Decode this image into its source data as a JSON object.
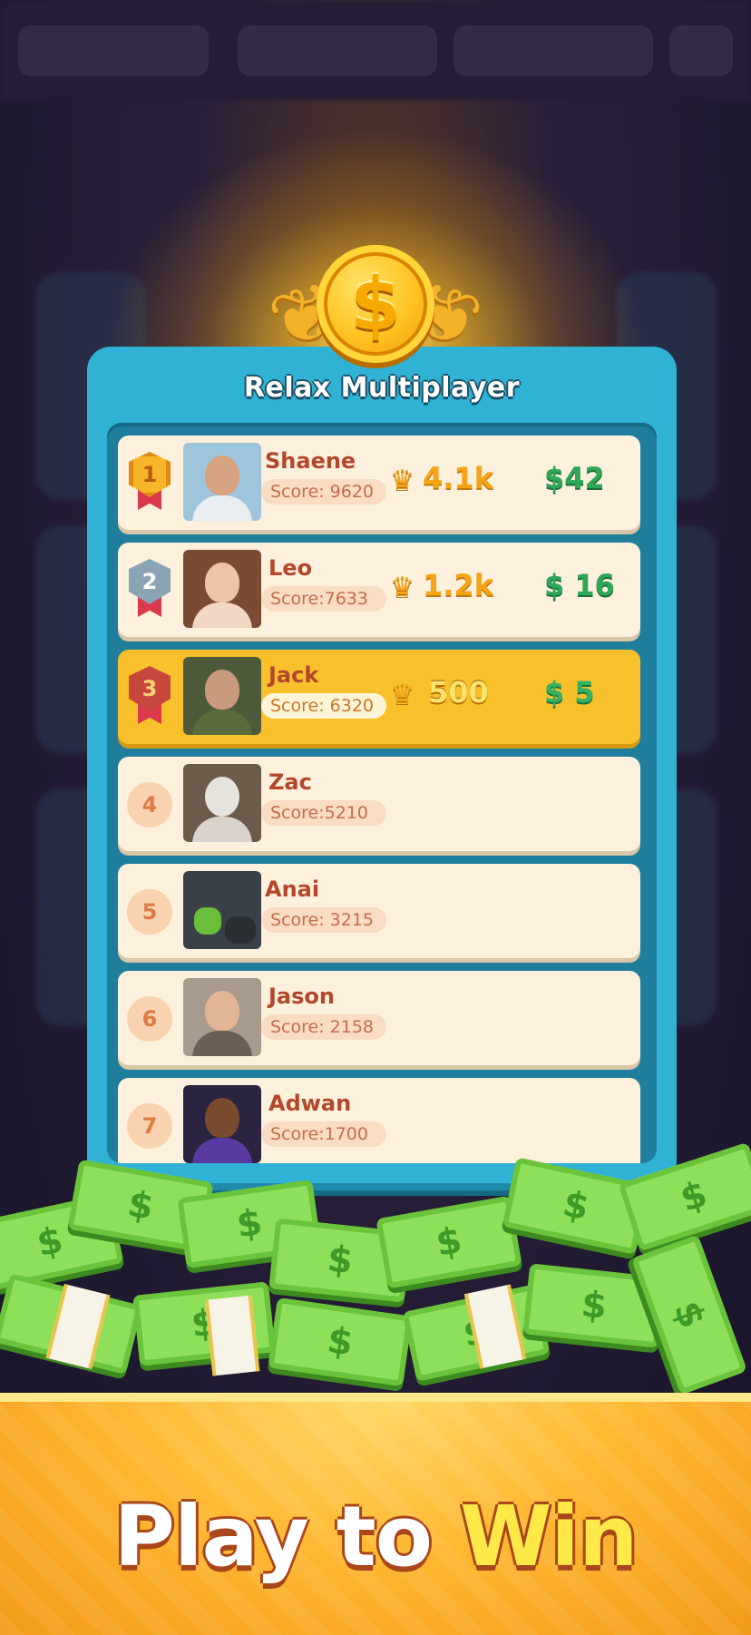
{
  "panel": {
    "title": "Relax Multiplayer"
  },
  "leaderboard": [
    {
      "rank": "1",
      "name": "Shaene",
      "score": "Score: 9620",
      "crowns": "4.1k",
      "cash": "$42",
      "badge": "gold"
    },
    {
      "rank": "2",
      "name": "Leo",
      "score": "Score:7633",
      "crowns": "1.2k",
      "cash": "$ 16",
      "badge": "silver"
    },
    {
      "rank": "3",
      "name": "Jack",
      "score": "Score: 6320",
      "crowns": "500",
      "cash": "$ 5",
      "badge": "bronze",
      "highlighted": true
    },
    {
      "rank": "4",
      "name": "Zac",
      "score": "Score:5210"
    },
    {
      "rank": "5",
      "name": "Anai",
      "score": "Score: 3215"
    },
    {
      "rank": "6",
      "name": "Jason",
      "score": "Score: 2158"
    },
    {
      "rank": "7",
      "name": "Adwan",
      "score": "Score:1700"
    }
  ],
  "banner": {
    "word1": "Play to",
    "word2": "Win"
  },
  "icons": {
    "coin": "dollar-coin-icon",
    "crown": "crown-icon",
    "laurel": "laurel-icon"
  },
  "colors": {
    "panel": "#2fb2d3",
    "row": "#fdf0dc",
    "highlight_row": "#f8c12b",
    "name": "#b3472c",
    "cash": "#2ea65a",
    "crown_value": "#f5a418",
    "banner": "#ffb933"
  }
}
